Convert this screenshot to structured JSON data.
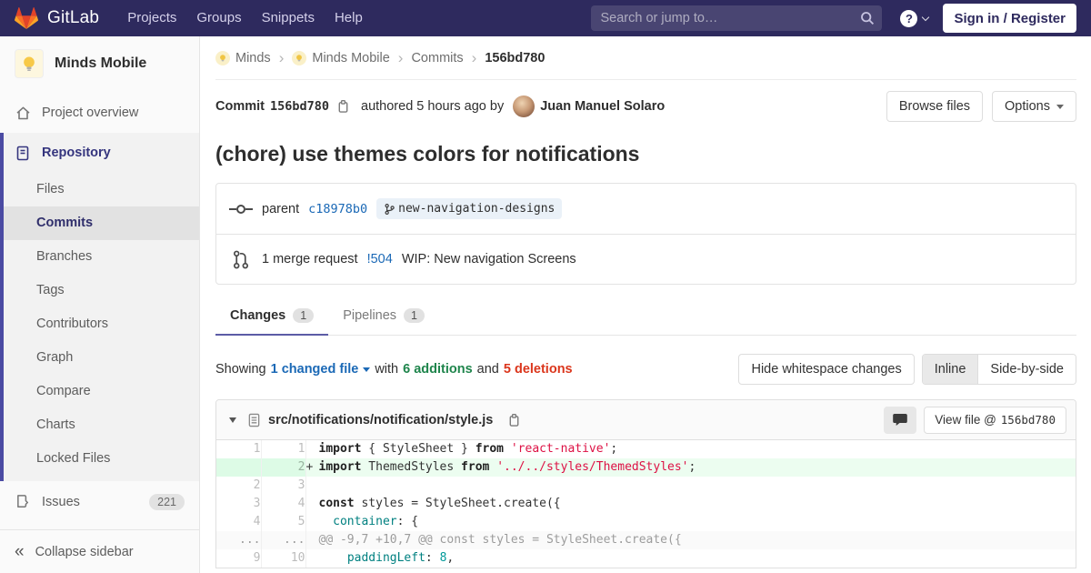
{
  "colors": {
    "navbar_bg": "#2e2a5e",
    "accent_indigo": "#4b4ba3",
    "link_blue": "#1b69b6",
    "additions_green": "#1f854c",
    "deletions_red": "#db361c",
    "added_line_bg": "#ecfdf0",
    "added_num_bg": "#ddfbe6",
    "brand_orange": "#fc6d26"
  },
  "icons": {
    "help_glyph": "?",
    "collapse_glyph": "«",
    "breadcrumb_separator": "›"
  },
  "navbar": {
    "brand": "GitLab",
    "menu": [
      "Projects",
      "Groups",
      "Snippets",
      "Help"
    ],
    "search_placeholder": "Search or jump to…",
    "sign_in": "Sign in / Register"
  },
  "sidebar": {
    "project_name": "Minds Mobile",
    "overview": "Project overview",
    "repository": {
      "label": "Repository",
      "items": [
        "Files",
        "Commits",
        "Branches",
        "Tags",
        "Contributors",
        "Graph",
        "Compare",
        "Charts",
        "Locked Files"
      ],
      "active_item": "Commits"
    },
    "issues": {
      "label": "Issues",
      "count": "221"
    },
    "collapse": "Collapse sidebar"
  },
  "breadcrumb": {
    "items": [
      {
        "label": "Minds",
        "avatar": true
      },
      {
        "label": "Minds Mobile",
        "avatar": true
      },
      {
        "label": "Commits"
      },
      {
        "label": "156bd780",
        "current": true
      }
    ]
  },
  "commit": {
    "label": "Commit",
    "sha": "156bd780",
    "authored": "authored 5 hours ago by",
    "author": "Juan Manuel Solaro",
    "browse_files": "Browse files",
    "options": "Options",
    "title": "(chore) use themes colors for notifications",
    "parent_label": "parent",
    "parent_sha": "c18978b0",
    "branch": "new-navigation-designs",
    "mr_text": "1 merge request",
    "mr_id": "!504",
    "mr_title": "WIP: New navigation Screens"
  },
  "tabs": [
    {
      "label": "Changes",
      "count": "1",
      "active": true
    },
    {
      "label": "Pipelines",
      "count": "1",
      "active": false
    }
  ],
  "diff_summary": {
    "showing": "Showing",
    "changed": "1 changed file",
    "with": "with",
    "additions": "6 additions",
    "and": "and",
    "deletions": "5 deletions"
  },
  "diff_controls": {
    "whitespace": "Hide whitespace changes",
    "inline": "Inline",
    "side_by_side": "Side-by-side",
    "inline_active": true
  },
  "file": {
    "path": "src/notifications/notification/style.js",
    "view_file": "View file @",
    "view_file_sha": "156bd780",
    "lines": [
      {
        "old": "1",
        "new": "1",
        "type": "ctx",
        "marker": "",
        "tokens": [
          [
            "k",
            "import"
          ],
          [
            "p",
            " { StyleSheet } "
          ],
          [
            "k",
            "from"
          ],
          [
            "p",
            " "
          ],
          [
            "s",
            "'react-native'"
          ],
          [
            "p",
            ";"
          ]
        ]
      },
      {
        "old": "",
        "new": "2",
        "type": "add",
        "marker": "+",
        "tokens": [
          [
            "k",
            "import"
          ],
          [
            "p",
            " ThemedStyles "
          ],
          [
            "k",
            "from"
          ],
          [
            "p",
            " "
          ],
          [
            "s",
            "'../../styles/ThemedStyles'"
          ],
          [
            "p",
            ";"
          ]
        ]
      },
      {
        "old": "2",
        "new": "3",
        "type": "ctx",
        "marker": "",
        "tokens": []
      },
      {
        "old": "3",
        "new": "4",
        "type": "ctx",
        "marker": "",
        "tokens": [
          [
            "k",
            "const"
          ],
          [
            "p",
            " styles = StyleSheet.create({"
          ]
        ]
      },
      {
        "old": "4",
        "new": "5",
        "type": "ctx",
        "marker": "",
        "tokens": [
          [
            "p",
            "  "
          ],
          [
            "n",
            "container"
          ],
          [
            "p",
            ": {"
          ]
        ]
      },
      {
        "old": "...",
        "new": "...",
        "type": "match",
        "marker": "",
        "tokens": [
          [
            "c",
            "@@ -9,7 +10,7 @@ const styles = StyleSheet.create({"
          ]
        ]
      },
      {
        "old": "9",
        "new": "10",
        "type": "ctx",
        "marker": "",
        "tokens": [
          [
            "p",
            "    "
          ],
          [
            "n",
            "paddingLeft"
          ],
          [
            "p",
            ": "
          ],
          [
            "m",
            "8"
          ],
          [
            "p",
            ","
          ]
        ]
      }
    ]
  }
}
